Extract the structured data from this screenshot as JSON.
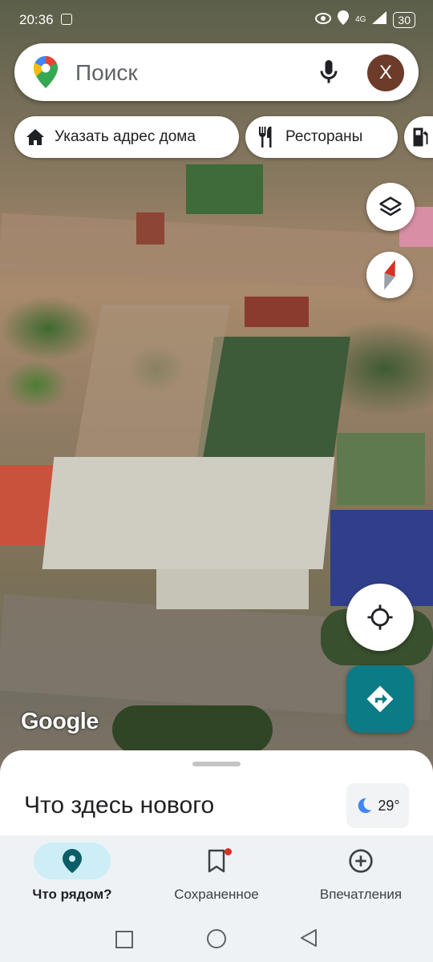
{
  "status_bar": {
    "time": "20:36",
    "network": "4G",
    "battery": "30"
  },
  "search": {
    "placeholder": "Поиск",
    "avatar_letter": "Х"
  },
  "chips": [
    {
      "label": "Указать адрес дома",
      "icon": "home-icon"
    },
    {
      "label": "Рестораны",
      "icon": "restaurant-icon"
    },
    {
      "label": "",
      "icon": "gas-station-icon"
    }
  ],
  "map": {
    "attribution": "Google"
  },
  "bottom_sheet": {
    "title": "Что здесь нового",
    "weather_temp": "29°",
    "weather_icon": "moon-icon"
  },
  "bottom_nav": [
    {
      "label": "Что рядом?",
      "icon": "location-pin-icon",
      "active": true
    },
    {
      "label": "Сохраненное",
      "icon": "bookmark-icon",
      "badge": true
    },
    {
      "label": "Впечатления",
      "icon": "add-circle-icon"
    }
  ],
  "colors": {
    "accent": "#0b7b86",
    "active_pill": "#cdeef6",
    "compass_red": "#d93025",
    "badge_red": "#d93025"
  }
}
